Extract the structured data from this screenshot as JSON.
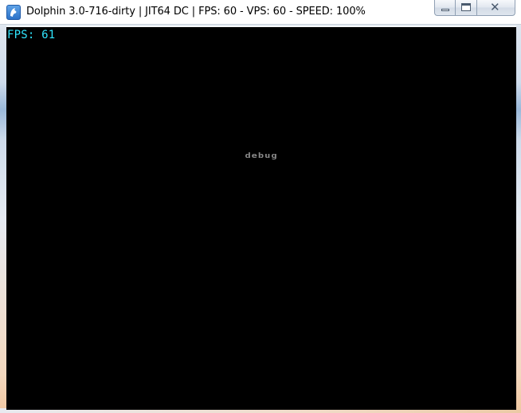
{
  "window": {
    "title": "Dolphin 3.0-716-dirty | JIT64 DC | FPS: 60 - VPS: 60 - SPEED: 100%",
    "icon": "dolphin-app-icon",
    "controls": {
      "minimize": "minimize-icon",
      "maximize": "maximize-icon",
      "close": "close-icon"
    }
  },
  "viewport": {
    "fps_overlay": "FPS: 61",
    "center_text": "debug"
  },
  "colors": {
    "fps_overlay": "#30e6ff",
    "viewport_bg": "#000000",
    "center_text": "#8a8a8a"
  }
}
